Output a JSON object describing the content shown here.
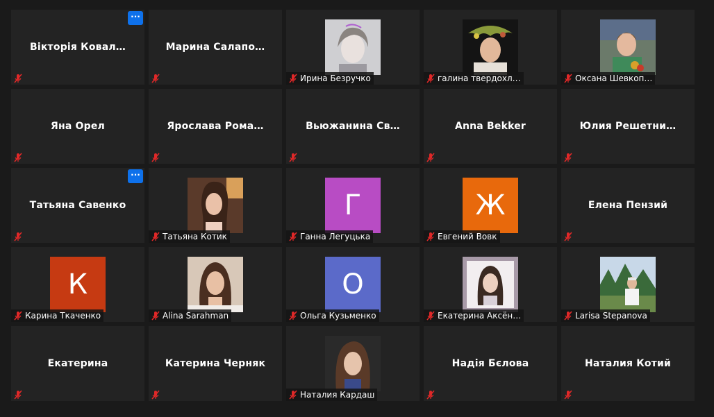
{
  "colors": {
    "background": "#1a1a1a",
    "tile": "#232323",
    "mute_red": "#e02828",
    "more_button": "#0e71eb"
  },
  "more_button_label": "···",
  "tiles": [
    {
      "name": "Вікторія  Ковал…",
      "display": "name",
      "more": true
    },
    {
      "name": "Марина  Салапо…",
      "display": "name"
    },
    {
      "name": "Ирина Безручко",
      "display": "photo"
    },
    {
      "name": "галина твердохл…",
      "display": "photo"
    },
    {
      "name": "Оксана Шевкоп…",
      "display": "photo"
    },
    {
      "name": "Яна Орел",
      "display": "name"
    },
    {
      "name": "Ярослава  Рома…",
      "display": "name"
    },
    {
      "name": "Вьюжанина  Св…",
      "display": "name"
    },
    {
      "name": "Anna Bekker",
      "display": "name"
    },
    {
      "name": "Юлия  Решетни…",
      "display": "name"
    },
    {
      "name": "Татьяна Савенко",
      "display": "name",
      "more": true
    },
    {
      "name": "Татьяна Котик",
      "display": "photo"
    },
    {
      "name": "Ганна Легуцька",
      "display": "avatar",
      "initial": "Г",
      "avatar_color": "#b84cc4"
    },
    {
      "name": "Евгений Вовк",
      "display": "avatar",
      "initial": "Ж",
      "avatar_color": "#e8690c"
    },
    {
      "name": "Елена Пензий",
      "display": "name"
    },
    {
      "name": "Карина Ткаченко",
      "display": "avatar",
      "initial": "К",
      "avatar_color": "#c63a12"
    },
    {
      "name": "Alina Sarahman",
      "display": "photo"
    },
    {
      "name": "Ольга Кузьменко",
      "display": "avatar",
      "initial": "О",
      "avatar_color": "#5b6ac9"
    },
    {
      "name": "Екатерина Аксён…",
      "display": "photo"
    },
    {
      "name": "Larisa Stepanova",
      "display": "photo"
    },
    {
      "name": "Екатерина",
      "display": "name"
    },
    {
      "name": "Катерина Черняк",
      "display": "name"
    },
    {
      "name": "Наталия Кардаш",
      "display": "photo"
    },
    {
      "name": "Надія Бєлова",
      "display": "name"
    },
    {
      "name": "Наталия Котий",
      "display": "name"
    }
  ]
}
